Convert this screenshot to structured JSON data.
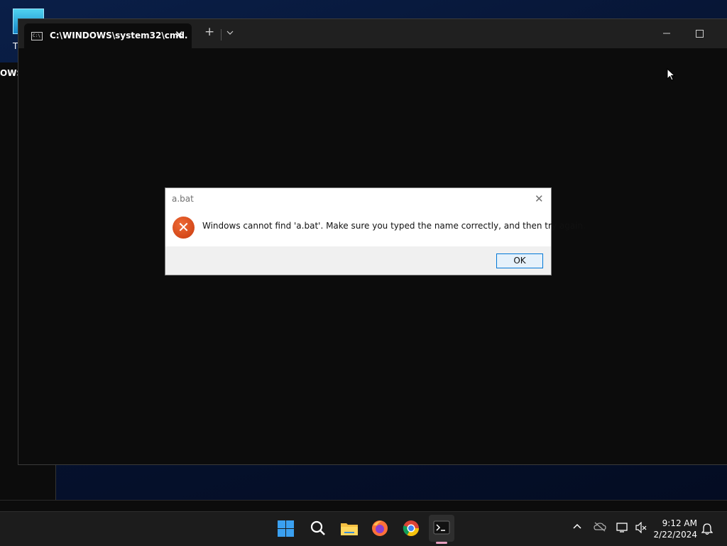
{
  "desktop": {
    "icon_label": "T",
    "background_window_title": "OWS\\"
  },
  "terminal": {
    "tab_title": "C:\\WINDOWS\\system32\\cmd.",
    "tab_close": "✕",
    "new_tab": "+",
    "dropdown": "⌄",
    "minimize": "—"
  },
  "dialog": {
    "title": "a.bat",
    "close": "✕",
    "icon": "✕",
    "message": "Windows cannot find 'a.bat'. Make sure you typed the name correctly, and then try again.",
    "ok_label": "OK"
  },
  "taskbar": {
    "pinned": [
      "start-icon",
      "search-icon",
      "file-explorer-icon",
      "firefox-icon",
      "chrome-icon",
      "terminal-icon"
    ],
    "tray": {
      "chevron": "^",
      "time": "9:12 AM",
      "date": "2/22/2024"
    }
  },
  "colors": {
    "error_icon": "#d83b01",
    "ok_border": "#0078d7",
    "terminal_bg": "#0c0c0c",
    "taskbar_bg": "#1c1c1c"
  }
}
